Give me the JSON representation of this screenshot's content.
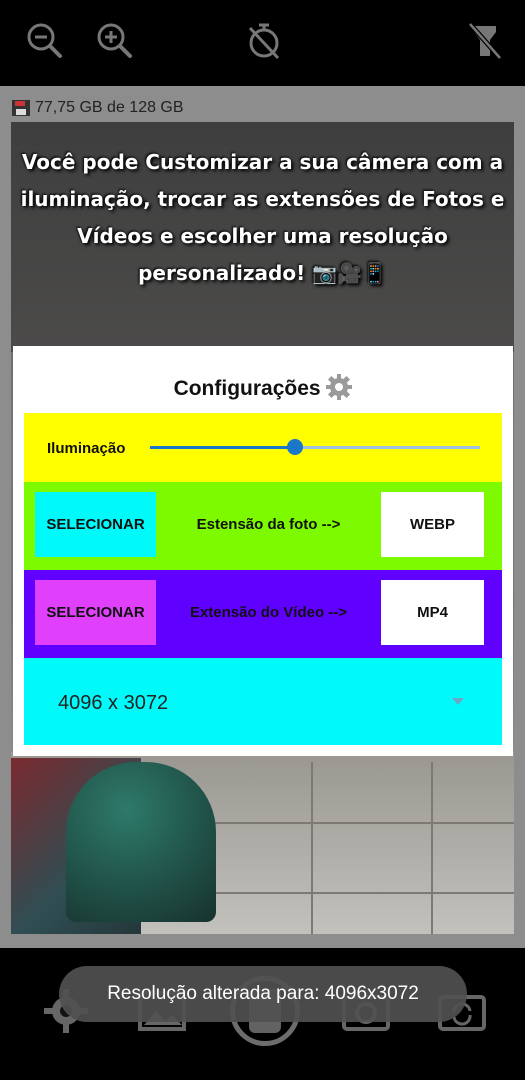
{
  "colors": {
    "illumination_row": "#ffff00",
    "photo_row": "#7dfa00",
    "photo_select_button": "#00fafa",
    "video_row": "#6000ff",
    "video_select_button": "#e040fb",
    "resolution_row": "#00fafa",
    "slider_accent": "#1a77c9"
  },
  "top_bar": {
    "icons": [
      "zoom-out-icon",
      "zoom-in-icon",
      "timer-off-icon",
      "flash-off-icon"
    ]
  },
  "storage": {
    "icon": "floppy-disk-icon",
    "text": "77,75 GB de 128 GB"
  },
  "banner": {
    "text": "Você pode Customizar a sua câmera com a iluminação, trocar as extensões de Fotos e Vídeos e escolher uma resolução personalizado! 📷🎥📱"
  },
  "settings_dialog": {
    "title": "Configurações",
    "title_icon": "gear-icon",
    "illumination": {
      "label": "Iluminação",
      "slider_fraction": 0.44
    },
    "photo": {
      "select_label": "SELECIONAR",
      "label": "Estensão da foto -->",
      "value": "WEBP"
    },
    "video": {
      "select_label": "SELECIONAR",
      "label": "Extensão do Vídeo -->",
      "value": "MP4"
    },
    "resolution": {
      "selected": "4096 x 3072"
    }
  },
  "bottom_bar": {
    "icons": [
      "settings-icon",
      "gallery-icon",
      "shutter-button",
      "camera-mode-icon",
      "switch-camera-icon"
    ]
  },
  "toast": {
    "text": "Resolução alterada para: 4096x3072"
  }
}
